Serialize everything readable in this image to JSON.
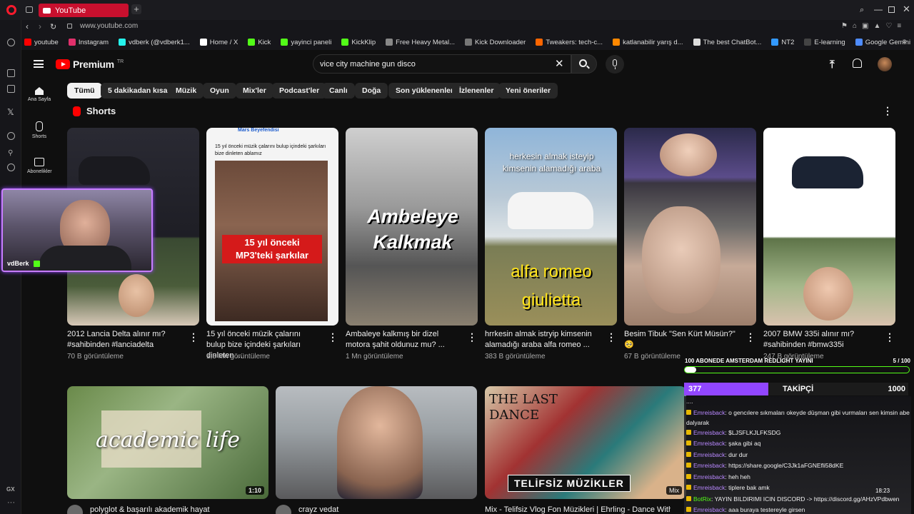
{
  "browser": {
    "tab_title": "YouTube",
    "url": "www.youtube.com",
    "bookmarks": [
      {
        "label": "youtube",
        "color": "#ff0000"
      },
      {
        "label": "Instagram",
        "color": "#e1306c"
      },
      {
        "label": "vdberk (@vdberk1...",
        "color": "#25f4ee"
      },
      {
        "label": "Home / X",
        "color": "#ffffff"
      },
      {
        "label": "Kick",
        "color": "#53fc18"
      },
      {
        "label": "yayinci paneli",
        "color": "#53fc18"
      },
      {
        "label": "KickKlip",
        "color": "#53fc18"
      },
      {
        "label": "Free Heavy Metal...",
        "color": "#888888"
      },
      {
        "label": "Kick Downloader",
        "color": "#777777"
      },
      {
        "label": "Tweakers: tech-c...",
        "color": "#ff6600"
      },
      {
        "label": "katlanabilir yarış d...",
        "color": "#ff8800"
      },
      {
        "label": "The best ChatBot...",
        "color": "#dddddd"
      },
      {
        "label": "NT2",
        "color": "#3399ff"
      },
      {
        "label": "E-learning",
        "color": "#444444"
      },
      {
        "label": "Google Gemini",
        "color": "#4f8cff"
      }
    ]
  },
  "youtube": {
    "logo_text": "Premium",
    "logo_sup": "TR",
    "search_value": "vice city machine gun disco",
    "nav": [
      {
        "label": "Ana Sayfa"
      },
      {
        "label": "Shorts"
      },
      {
        "label": "Abonelikler"
      }
    ],
    "chips": [
      "Tümü",
      "5 dakikadan kısa",
      "Müzik",
      "Oyun",
      "Mix'ler",
      "Podcast'ler",
      "Canlı",
      "Doğa",
      "Son yüklenenler",
      "İzlenenler",
      "Yeni öneriler"
    ],
    "shorts_header": "Shorts",
    "shorts": [
      {
        "title": "2012 Lancia Delta alınır mı? #sahibinden  #lanciadelta",
        "views": "70 B görüntüleme"
      },
      {
        "title": "15 yıl önceki müzik çalarını bulup bize içindeki şarkıları dinleten ...",
        "views": "1,3 Mn görüntüleme",
        "overlay_top": "Mars Beyefendisi",
        "overlay_text": "15 yıl önceki müzik çalarını bulup içindeki şarkıları bize dinleten ablamız",
        "overlay_label": "15 yıl önceki MP3'teki şarkılar"
      },
      {
        "title": "Ambaleye kalkmış bir dizel motora şahit oldunuz mu? ...",
        "views": "1 Mn görüntüleme",
        "overlay_text": "Ambeleye Kalkmak"
      },
      {
        "title": "hrrkesin almak istryip kimsenin alamadığı araba alfa romeo ...",
        "views": "383 B görüntüleme",
        "overlay_top": "herkesin almak isteyip kimsenin alamadığı araba",
        "overlay_text": "alfa romeo giulietta"
      },
      {
        "title": "Besim Tibuk \"Sen Kürt Müsün?\" 🥺",
        "views": "67 B görüntüleme"
      },
      {
        "title": "2007 BMW 335i alınır mı? #sahibinden  #bmw335i",
        "views": "247 B görüntüleme"
      }
    ],
    "videos": [
      {
        "title": "polyglot & başarılı akademik hayat",
        "duration": "1:10",
        "overlay_text": "academic life"
      },
      {
        "title": "crayz vedat",
        "duration": ""
      },
      {
        "title": "Mix - Telifsiz Vlog Fon Müzikleri | Ehrling - Dance With",
        "overlay_text": "TELİFSİZ MÜZİKLER",
        "overlay_top": "THE LAST DANCE",
        "badge": "Mix"
      }
    ]
  },
  "stream": {
    "webcam_name": "vdBerk",
    "goal_text": "100 ABONEDE AMSTERDAM REDLIGHT YAYINI",
    "goal_progress": "5 / 100",
    "goal_fraction": 0.05,
    "follower_current": "377",
    "follower_label": "TAKİPÇİ",
    "follower_target": "1000",
    "follower_fraction": 0.377,
    "time": "18:23",
    "chat": [
      {
        "user": "",
        "msg": "...."
      },
      {
        "user": "Emreisback",
        "msg": ": o gencılere sıkmaları okeyde düşman gibi vurmaları sen kimsin abe dalyarak"
      },
      {
        "user": "Emreisback",
        "msg": ": $LJSFLKJLFKSDG"
      },
      {
        "user": "Emreisback",
        "msg": ": şaka gibi aq"
      },
      {
        "user": "Emreisback",
        "msg": ": dur dur"
      },
      {
        "user": "Emreisback",
        "msg": ": https://share.google/C3Jk1aFGNEfli58dKE"
      },
      {
        "user": "Emreisback",
        "msg": ": heh heh"
      },
      {
        "user": "Emreisback",
        "msg": ": tiplere bak amk"
      },
      {
        "user": "BotRix",
        "msg": ": YAYIN BILDIRIMI ICIN DISCORD -> https://discord.gg/AHzVPdbwen"
      },
      {
        "user": "Emreisback",
        "msg": ": aaa buraya testereyle girsen"
      }
    ]
  },
  "colors": {
    "yt_red": "#ff0000",
    "goal_green": "#53fc18",
    "follower_purple": "#9146ff",
    "webcam_border": "#c87dff"
  }
}
